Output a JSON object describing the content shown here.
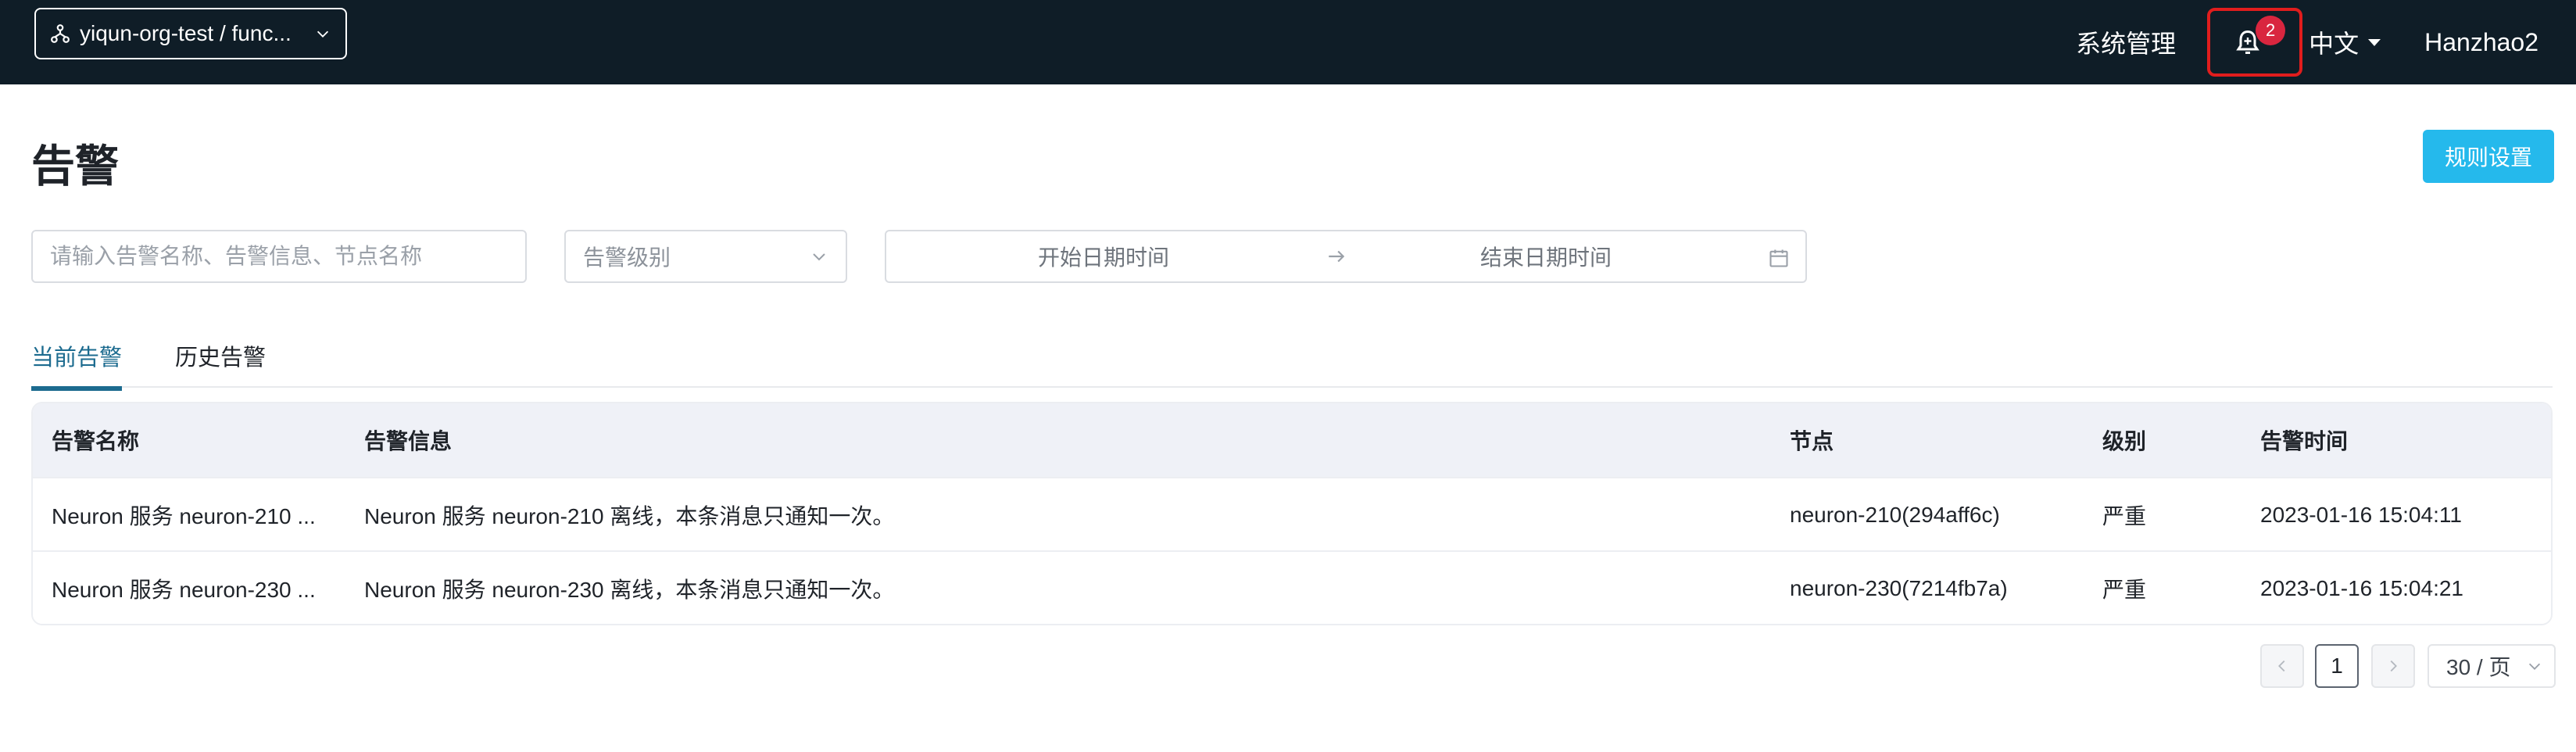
{
  "header": {
    "org_selector": "yiqun-org-test / func...",
    "system_management": "系统管理",
    "notifications_count": "2",
    "language": "中文",
    "username": "Hanzhao2"
  },
  "page": {
    "title": "告警",
    "rule_settings_button": "规则设置"
  },
  "filters": {
    "search_placeholder": "请输入告警名称、告警信息、节点名称",
    "level_placeholder": "告警级别",
    "start_date_placeholder": "开始日期时间",
    "end_date_placeholder": "结束日期时间"
  },
  "tabs": [
    {
      "label": "当前告警",
      "active": true
    },
    {
      "label": "历史告警",
      "active": false
    }
  ],
  "table": {
    "columns": [
      "告警名称",
      "告警信息",
      "节点",
      "级别",
      "告警时间"
    ],
    "rows": [
      {
        "name": "Neuron 服务 neuron-210 ...",
        "info": "Neuron 服务 neuron-210 离线，本条消息只通知一次。",
        "node": "neuron-210(294aff6c)",
        "level": "严重",
        "time": "2023-01-16 15:04:11"
      },
      {
        "name": "Neuron 服务 neuron-230 ...",
        "info": "Neuron 服务 neuron-230 离线，本条消息只通知一次。",
        "node": "neuron-230(7214fb7a)",
        "level": "严重",
        "time": "2023-01-16 15:04:21"
      }
    ]
  },
  "pagination": {
    "current_page": "1",
    "page_size": "30 / 页"
  },
  "colors": {
    "header_bg": "#0f1d27",
    "primary_button": "#25b9ec",
    "active_tab": "#1c6b8f",
    "badge": "#d9263f",
    "highlight_box": "#e11d1d"
  },
  "icons": [
    "org-icon",
    "chevron-down-icon",
    "bell-icon",
    "caret-down-icon",
    "arrow-right-icon",
    "calendar-icon",
    "chevron-left-icon",
    "chevron-right-icon"
  ]
}
